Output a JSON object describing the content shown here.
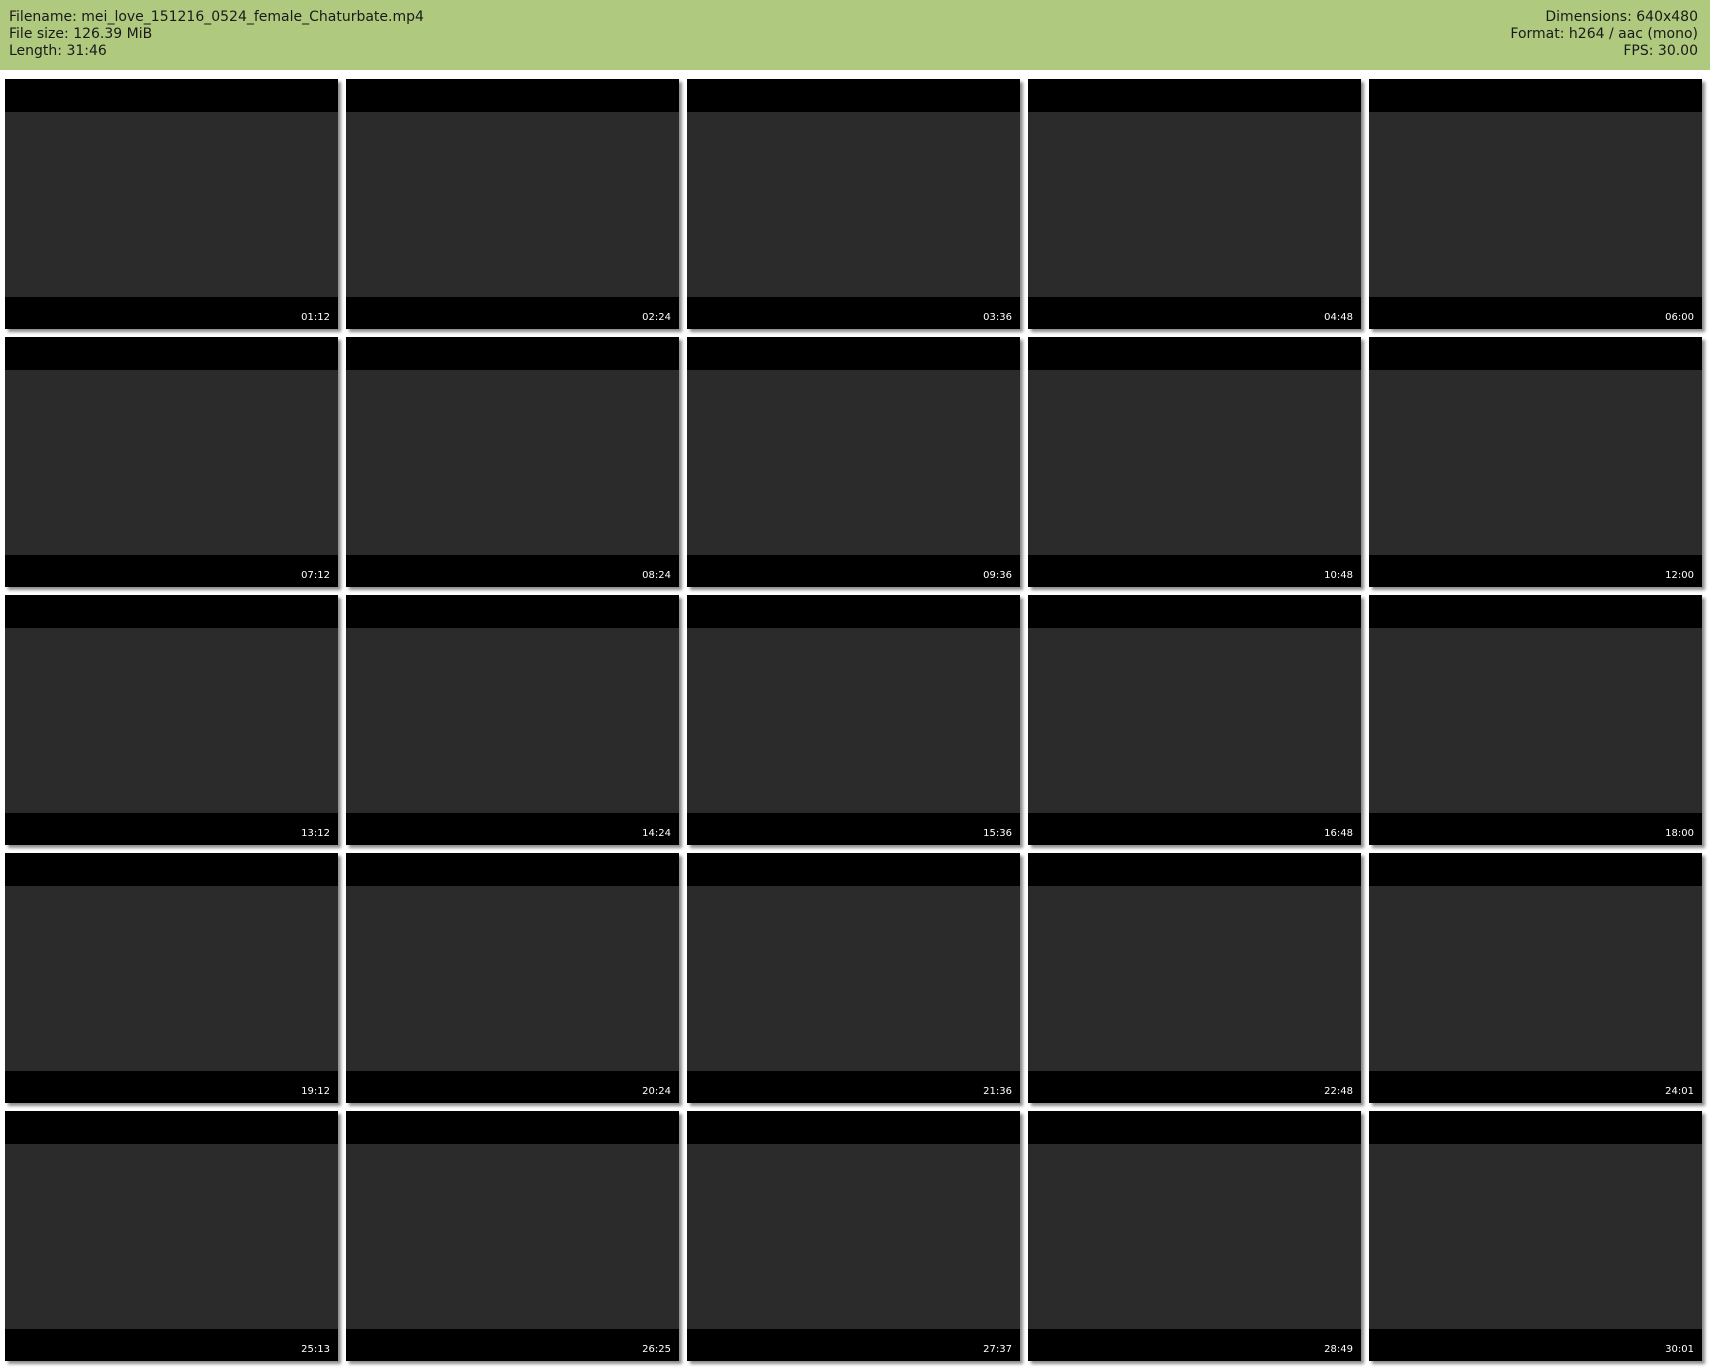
{
  "header": {
    "filename": "Filename: mei_love_151216_0524_female_Chaturbate.mp4",
    "filesize": "File size: 126.39 MiB",
    "length": "Length: 31:46",
    "dimensions": "Dimensions: 640x480",
    "format": "Format: h264 / aac (mono)",
    "fps": "FPS: 30.00"
  },
  "frames": [
    {
      "timestamp": "01:12"
    },
    {
      "timestamp": "02:24"
    },
    {
      "timestamp": "03:36"
    },
    {
      "timestamp": "04:48"
    },
    {
      "timestamp": "06:00"
    },
    {
      "timestamp": "07:12"
    },
    {
      "timestamp": "08:24"
    },
    {
      "timestamp": "09:36"
    },
    {
      "timestamp": "10:48"
    },
    {
      "timestamp": "12:00"
    },
    {
      "timestamp": "13:12"
    },
    {
      "timestamp": "14:24"
    },
    {
      "timestamp": "15:36"
    },
    {
      "timestamp": "16:48"
    },
    {
      "timestamp": "18:00"
    },
    {
      "timestamp": "19:12"
    },
    {
      "timestamp": "20:24"
    },
    {
      "timestamp": "21:36"
    },
    {
      "timestamp": "22:48"
    },
    {
      "timestamp": "24:01"
    },
    {
      "timestamp": "25:13"
    },
    {
      "timestamp": "26:25"
    },
    {
      "timestamp": "27:37"
    },
    {
      "timestamp": "28:49"
    },
    {
      "timestamp": "30:01"
    }
  ]
}
